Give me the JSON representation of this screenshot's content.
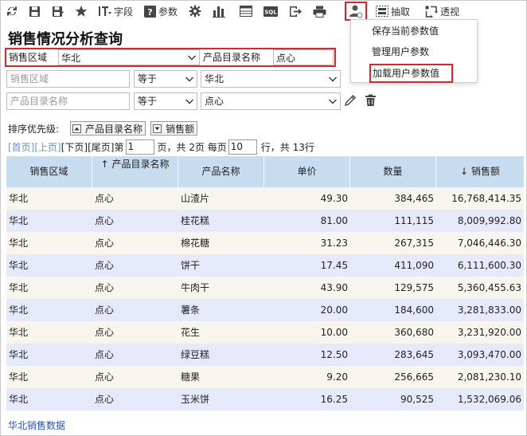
{
  "toolbar": {
    "field_label": "字段",
    "param_label": "参数",
    "extract_label": "抽取",
    "pivot_label": "透视",
    "sql_label": "SQL"
  },
  "user_menu": {
    "items": [
      "保存当前参数值",
      "管理用户参数",
      "加载用户参数值"
    ]
  },
  "title": "销售情况分析查询",
  "param_row": {
    "region_label": "销售区域",
    "region_value": "华北",
    "catalog_label": "产品目录名称",
    "catalog_value": "点心"
  },
  "filter1": {
    "field_placeholder": "销售区域",
    "operator": "等于",
    "value": "华北"
  },
  "filter2": {
    "field_placeholder": "产品目录名称",
    "operator": "等于",
    "value": "点心"
  },
  "sort": {
    "label": "排序优先级:",
    "chips": [
      "产品目录名称",
      "销售额"
    ]
  },
  "pager": {
    "first": "[首页]",
    "prev": "[上页]",
    "next": "[下页]",
    "last": "[尾页]",
    "page_prefix": "第",
    "current_page": "1",
    "page_mid": "页，共 2页 每页",
    "page_size": "10",
    "page_suffix": "行，共 13行"
  },
  "table": {
    "headers": [
      "销售区域",
      "产品目录名称",
      "产品名称",
      "单价",
      "数量",
      "销售额"
    ],
    "header_sort_marks": [
      "",
      "↑",
      "",
      "",
      "",
      "↓"
    ],
    "rows": [
      [
        "华北",
        "点心",
        "山渣片",
        "49.30",
        "384,465",
        "16,768,414.35"
      ],
      [
        "华北",
        "点心",
        "桂花糕",
        "81.00",
        "111,115",
        "8,009,992.80"
      ],
      [
        "华北",
        "点心",
        "棉花糖",
        "31.23",
        "267,315",
        "7,046,446.30"
      ],
      [
        "华北",
        "点心",
        "饼干",
        "17.45",
        "411,090",
        "6,111,600.30"
      ],
      [
        "华北",
        "点心",
        "牛肉干",
        "43.90",
        "129,575",
        "5,360,455.63"
      ],
      [
        "华北",
        "点心",
        "薯条",
        "20.00",
        "184,600",
        "3,281,833.00"
      ],
      [
        "华北",
        "点心",
        "花生",
        "10.00",
        "360,680",
        "3,231,920.00"
      ],
      [
        "华北",
        "点心",
        "绿豆糕",
        "12.50",
        "283,645",
        "3,093,470.00"
      ],
      [
        "华北",
        "点心",
        "糖果",
        "9.20",
        "256,665",
        "2,081,230.10"
      ],
      [
        "华北",
        "点心",
        "玉米饼",
        "16.25",
        "90,525",
        "1,532,069.06"
      ]
    ]
  },
  "footer_link": "华北销售数据",
  "colors": {
    "highlight_border": "#d9262b",
    "header_bg": "#c7dcee",
    "row_odd": "#f7f5ee",
    "row_even": "#e6e9fa",
    "link": "#2a55b0"
  }
}
